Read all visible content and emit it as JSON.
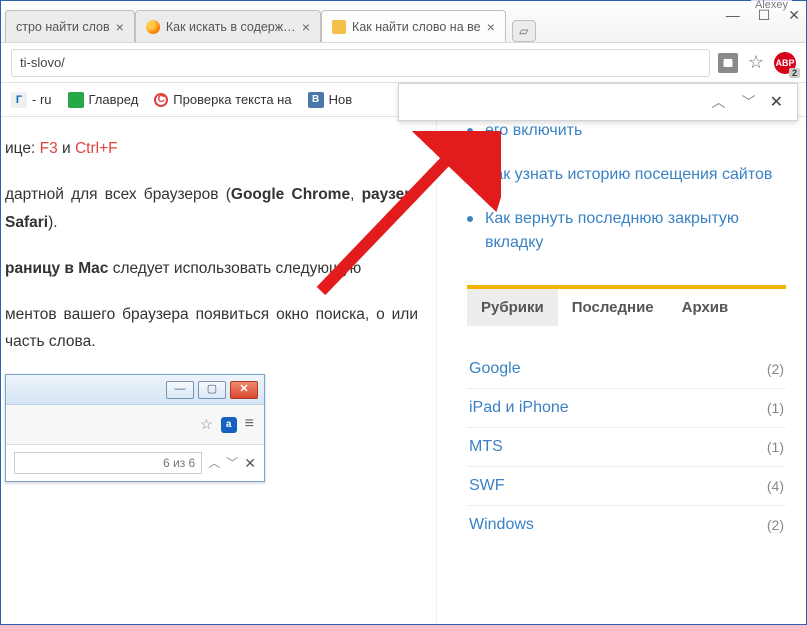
{
  "window": {
    "user": "Alexey"
  },
  "tabs": [
    {
      "title": "стро найти слов"
    },
    {
      "title": "Как искать в содержим"
    },
    {
      "title": "Как найти слово на ве"
    }
  ],
  "address": {
    "url": "ti-slovo/",
    "abp_count": "2"
  },
  "bookmarks": [
    {
      "label": "- ru"
    },
    {
      "label": "Главред"
    },
    {
      "label": "Проверка текста на"
    },
    {
      "label": "Нов"
    }
  ],
  "findbar": {
    "value": ""
  },
  "article": {
    "p1a": "ице: ",
    "p1_f3": "F3",
    "p1_mid": " и ",
    "p1_ctrlf": "Ctrl+F",
    "p2a": "дартной для всех браузеров (",
    "p2_bold1": "Google Chrome",
    "p2_mid": ", ",
    "p2_bold2": "раузер",
    "p2_c": ", ",
    "p2_bold3": "Safari",
    "p2_end": ").",
    "p3a": "раницу в Mac",
    "p3b": " следует использовать следующую",
    "p4": "ментов вашего браузера появиться окно поиска, о или часть слова."
  },
  "thumb": {
    "count": "6 из 6"
  },
  "sidebar": {
    "items": [
      "его включить",
      "Как узнать историю посещения сайтов",
      "Как вернуть последнюю закрытую вкладку"
    ],
    "tabs": [
      {
        "label": "Рубрики",
        "active": true
      },
      {
        "label": "Последние",
        "active": false
      },
      {
        "label": "Архив",
        "active": false
      }
    ],
    "categories": [
      {
        "name": "Google",
        "count": "(2)"
      },
      {
        "name": "iPad и iPhone",
        "count": "(1)"
      },
      {
        "name": "MTS",
        "count": "(1)"
      },
      {
        "name": "SWF",
        "count": "(4)"
      },
      {
        "name": "Windows",
        "count": "(2)"
      }
    ]
  }
}
